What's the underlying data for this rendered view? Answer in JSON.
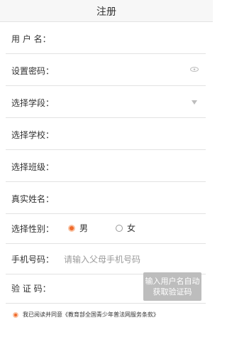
{
  "header": {
    "title": "注册"
  },
  "form": {
    "username_label": "用 户 名：",
    "password_label": "设置密码：",
    "section_label": "选择学段：",
    "school_label": "选择学校：",
    "class_label": "选择班级：",
    "realname_label": "真实姓名：",
    "gender_label": "选择性别：",
    "gender_options": [
      "男",
      "女"
    ],
    "gender_selected": "男",
    "phone_label": "手机号码：",
    "phone_placeholder": "请输入父母手机号码",
    "code_label": "验 证 码：",
    "code_button_line1": "输入用户名自动",
    "code_button_line2": "获取验证码"
  },
  "agreement": {
    "checked": true,
    "text": "我已阅读并同意《教育部全国青少年普法网服务条款》"
  },
  "icons": {
    "password_toggle": "eye-icon",
    "dropdown": "chevron-down-icon",
    "radio_selected": "radio-selected-icon",
    "radio_unselected": "radio-unselected-icon",
    "checkbox_checked": "checkbox-checked-icon"
  },
  "colors": {
    "accent": "#f06a2b",
    "button_bg": "#bdbdbd"
  }
}
